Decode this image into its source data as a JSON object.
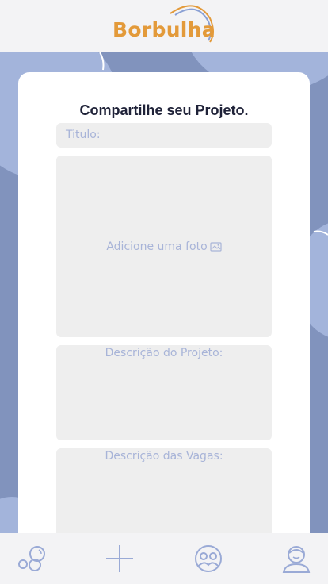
{
  "header": {
    "logo_text": "Borbulha"
  },
  "form": {
    "title": "Compartilhe seu Projeto.",
    "title_field_placeholder": "Titulo:",
    "photo_label": "Adicione uma foto",
    "description_label": "Descrição do Projeto:",
    "vacancies_label": "Descrição das Vagas:"
  },
  "nav": {
    "items": [
      {
        "icon": "bubbles-icon"
      },
      {
        "icon": "plus-icon"
      },
      {
        "icon": "group-icon"
      },
      {
        "icon": "profile-icon"
      }
    ]
  },
  "colors": {
    "background": "#8193bd",
    "bubble": "#a3b4db",
    "logo": "#e39a3a",
    "logo_arc": "#8aa0d4",
    "field": "#eeeeee",
    "placeholder": "#a8b4d8",
    "nav_icon": "#9aaad6"
  }
}
